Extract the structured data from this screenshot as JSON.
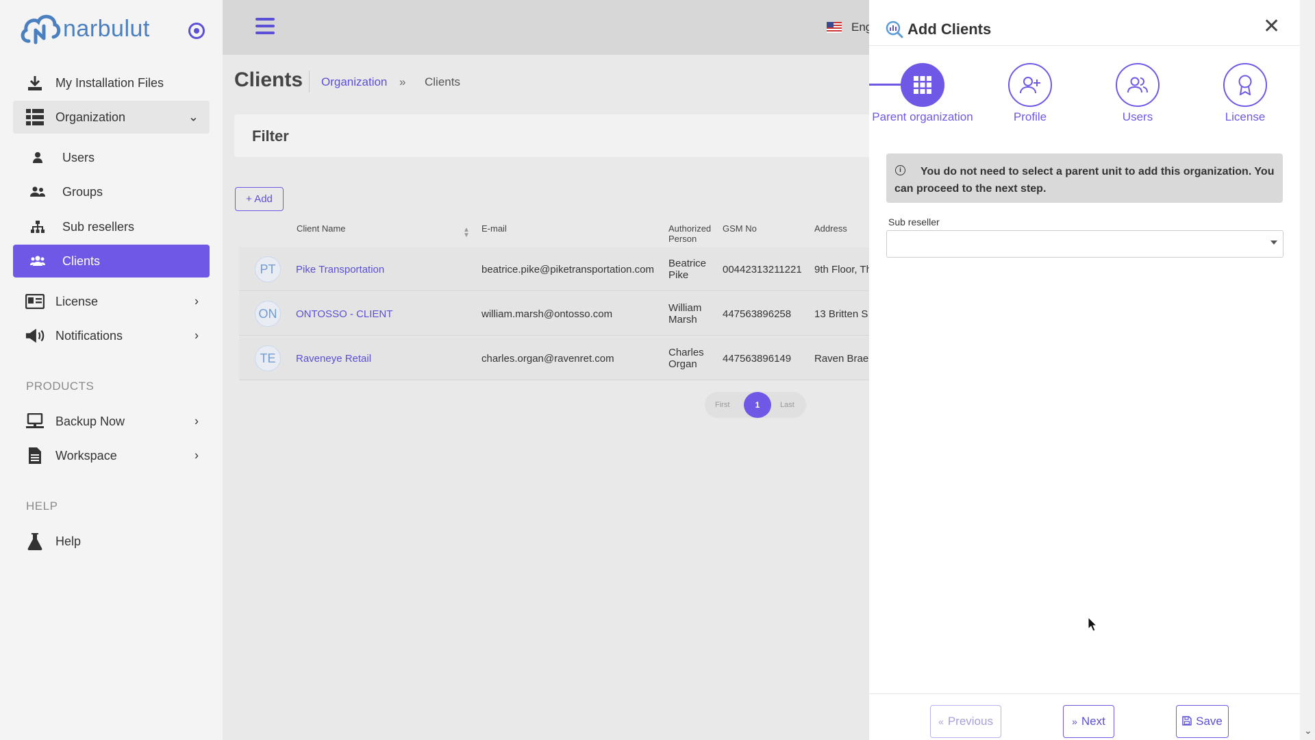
{
  "brand": {
    "name": "narbulut"
  },
  "sidebar": {
    "items": [
      {
        "label": "My Installation Files",
        "icon": "download-icon"
      },
      {
        "label": "Organization",
        "icon": "grid-icon"
      },
      {
        "label": "Users",
        "icon": "user-icon"
      },
      {
        "label": "Groups",
        "icon": "users-icon"
      },
      {
        "label": "Sub resellers",
        "icon": "sitemap-icon"
      },
      {
        "label": "Clients",
        "icon": "users-icon"
      },
      {
        "label": "License",
        "icon": "id-card-icon"
      },
      {
        "label": "Notifications",
        "icon": "megaphone-icon"
      },
      {
        "label": "Backup Now",
        "icon": "server-icon"
      },
      {
        "label": "Workspace",
        "icon": "document-icon"
      },
      {
        "label": "Help",
        "icon": "flask-icon"
      }
    ],
    "section_products": "PRODUCTS",
    "section_help": "HELP"
  },
  "header": {
    "language": "Eng"
  },
  "page": {
    "title": "Clients",
    "breadcrumb": [
      "Organization",
      "»",
      "Clients"
    ],
    "filter_label": "Filter",
    "add_label": "+ Add"
  },
  "table": {
    "headers": [
      "Client Name",
      "E-mail",
      "Authorized Person",
      "GSM No",
      "Address"
    ],
    "rows": [
      {
        "initials": "PT",
        "name": "Pike Transportation",
        "email": "beatrice.pike@piketransportation.com",
        "person": "Beatrice Pike",
        "gsm": "00442313211221",
        "address": "9th Floor, Th"
      },
      {
        "initials": "ON",
        "name": "ONTOSSO - CLIENT",
        "email": "william.marsh@ontosso.com",
        "person": "William Marsh",
        "gsm": "447563896258",
        "address": "13 Britten S"
      },
      {
        "initials": "TE",
        "name": "Raveneye Retail",
        "email": "charles.organ@ravenret.com",
        "person": "Charles Organ",
        "gsm": "447563896149",
        "address": "Raven Brae"
      }
    ]
  },
  "pagination": {
    "first": "First",
    "current": "1",
    "last": "Last"
  },
  "drawer": {
    "title": "Add Clients",
    "steps": [
      "Parent organization",
      "Profile",
      "Users",
      "License"
    ],
    "alert": "You do not need to select a parent unit to add this organization. You can proceed to the next step.",
    "sub_reseller_label": "Sub reseller",
    "sub_reseller_value": "",
    "buttons": {
      "previous": "Previous",
      "next": "Next",
      "save": "Save"
    }
  },
  "colors": {
    "accent": "#6f58e6",
    "link": "#5b4fd6"
  }
}
